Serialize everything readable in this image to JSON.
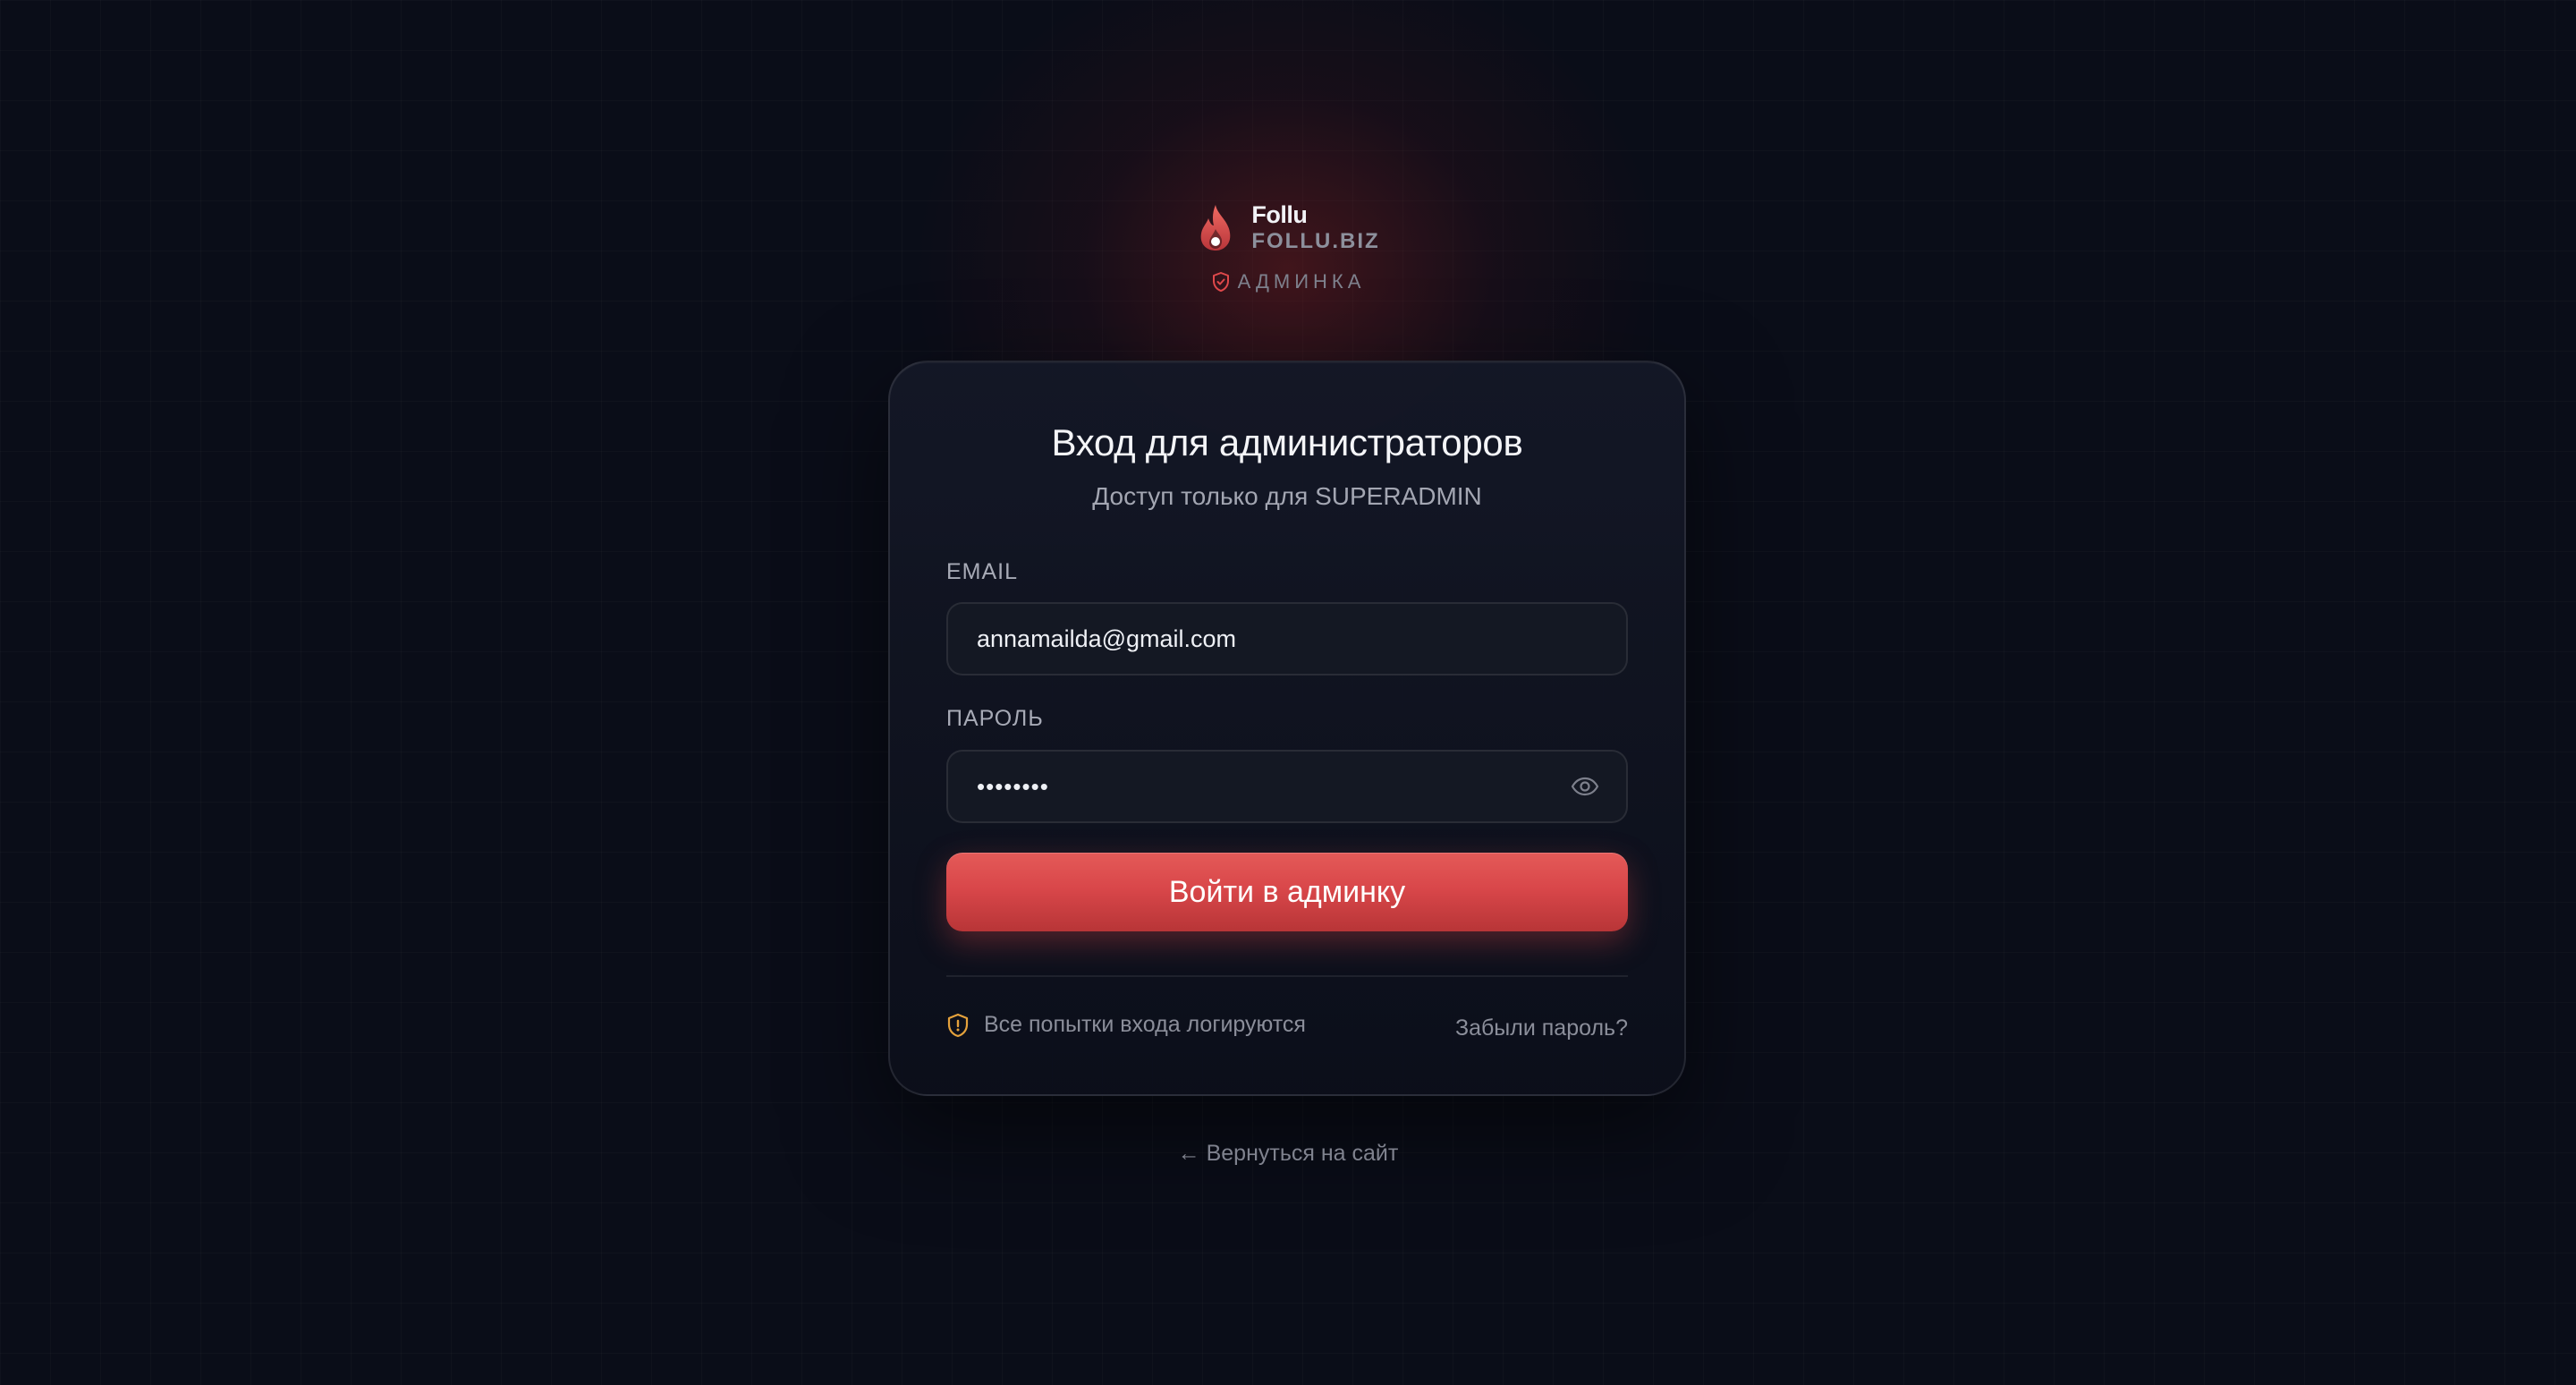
{
  "brand": {
    "name": "Follu",
    "domain": "FOLLU.BIZ",
    "section_label": "АДМИНКА",
    "icon": "flame-icon",
    "badge_icon": "shield-check-icon"
  },
  "card": {
    "title": "Вход для администраторов",
    "subtitle": "Доступ только для SUPERADMIN"
  },
  "form": {
    "email_label": "EMAIL",
    "email_value": "annamailda@gmail.com",
    "password_label": "ПАРОЛЬ",
    "password_value": "••••••••",
    "password_toggle_icon": "eye-icon",
    "submit_label": "Войти в админку"
  },
  "footer": {
    "note_icon": "shield-alert-icon",
    "note": "Все попытки входа логируются",
    "forgot_password": "Забыли пароль?"
  },
  "back_link": "← Вернуться на сайт",
  "colors": {
    "background": "#0a0d18",
    "accent": "#d9474a",
    "warning": "#e5a23c"
  }
}
